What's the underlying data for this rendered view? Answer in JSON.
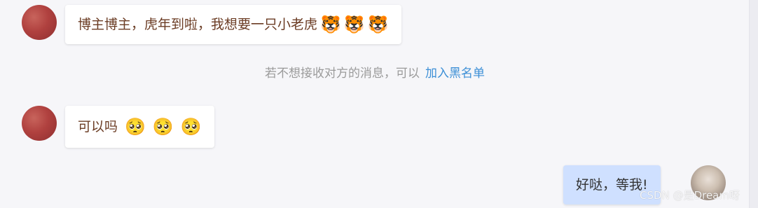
{
  "messages": [
    {
      "sender": "other",
      "text": "博主博主，虎年到啦，我想要一只小老虎",
      "emojis": [
        "🐯",
        "🐯",
        "🐯"
      ]
    },
    {
      "sender": "other",
      "text": "可以吗",
      "emojis": [
        "🥺",
        "🥺",
        "🥺"
      ]
    },
    {
      "sender": "self",
      "text": "好哒，等我!"
    }
  ],
  "system_notice": {
    "text": "若不想接收对方的消息，可以",
    "link": "加入黑名单"
  },
  "watermark": "CSDN @是Dream呀",
  "colors": {
    "background": "#f6f6f9",
    "bubble_other": "#ffffff",
    "bubble_self": "#cfe0ff",
    "link": "#3c8fd6",
    "text_other": "#6b3c24"
  }
}
